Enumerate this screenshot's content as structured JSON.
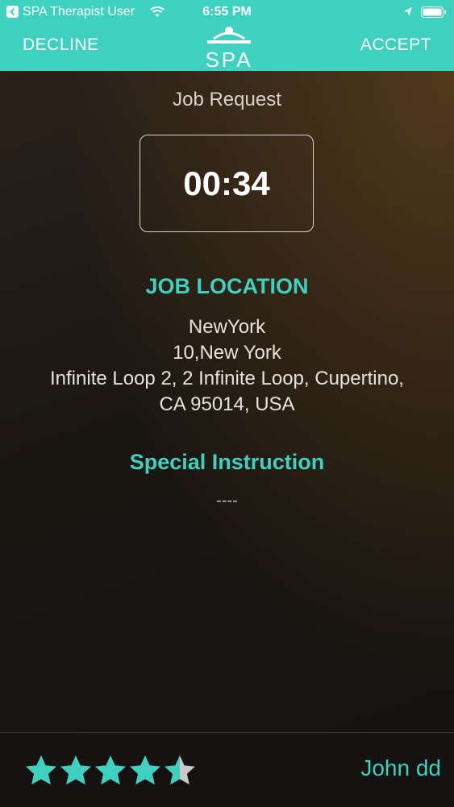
{
  "status_bar": {
    "back_icon": "back-arrow-icon",
    "carrier": "SPA Therapist User",
    "time": "6:55 PM"
  },
  "nav": {
    "decline_label": "DECLINE",
    "accept_label": "ACCEPT",
    "logo_text": "SPA"
  },
  "job": {
    "title": "Job Request",
    "timer": "00:34",
    "location_heading": "JOB LOCATION",
    "address_lines": [
      "NewYork",
      "10,New York",
      "Infinite Loop 2,  2 Infinite Loop,  Cupertino,",
      "CA 95014,  USA"
    ],
    "instruction_heading": "Special Instruction",
    "instruction_text": "----"
  },
  "footer": {
    "rating": 4.5,
    "max_rating": 5,
    "user_name": "John dd"
  },
  "colors": {
    "accent": "#3fd0c0",
    "star_empty": "#c9c9c9"
  }
}
